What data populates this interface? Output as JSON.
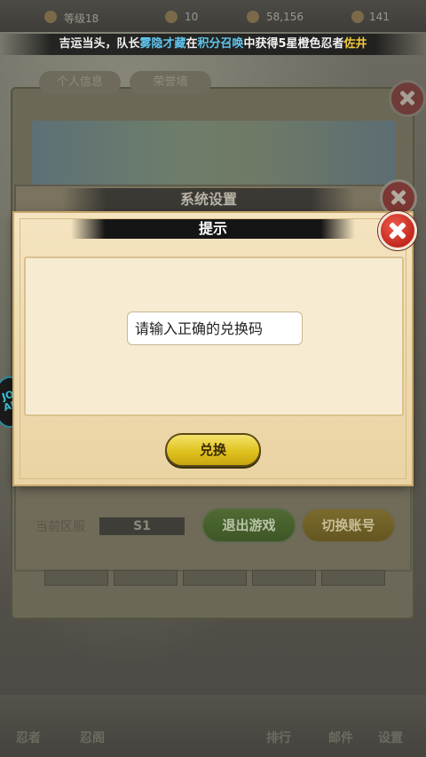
{
  "top_bar": {
    "stat_1": "等级18",
    "stat_2": "10",
    "stat_3": "58,156",
    "stat_4": "141"
  },
  "marquee": {
    "part_1": "吉运当头，队长",
    "name_1": "雾隐才藏",
    "part_2": "在",
    "name_2": "积分召唤",
    "part_3": "中获得5星橙色忍者",
    "name_3": "佐井"
  },
  "profile_panel": {
    "tabs": [
      "个人信息",
      "荣誉墙"
    ]
  },
  "settings": {
    "title": "系统设置",
    "server_label": "当前区服",
    "server_value": "S1",
    "logout_label": "退出游戏",
    "switch_account_label": "切换账号"
  },
  "dialog": {
    "title": "提示",
    "input_placeholder": "请输入正确的兑换码",
    "redeem_label": "兑换"
  },
  "side_badge": {
    "text": "JO AN"
  },
  "bottom_nav": {
    "items": [
      "忍者",
      "忍阁",
      "排行",
      "邮件",
      "设置"
    ]
  },
  "colors": {
    "marquee_highlight_blue": "#5fc6ee",
    "marquee_highlight_yellow": "#f3c83c",
    "dialog_bg": "#f4e4c0",
    "redeem_button": "#e0c21f",
    "close_button": "#c2281e"
  }
}
